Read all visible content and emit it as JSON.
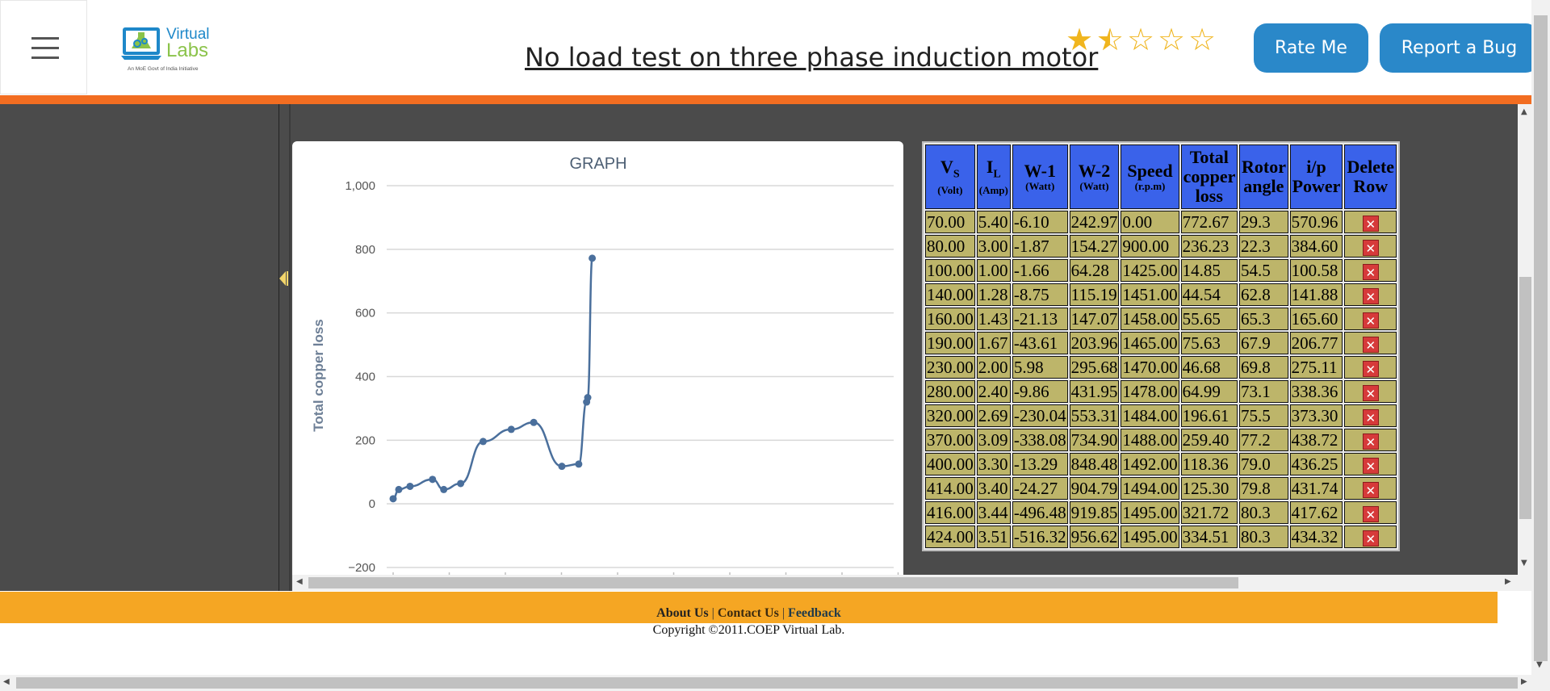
{
  "header": {
    "title": "No load test on three phase induction motor",
    "logo": {
      "name": "Virtual Labs",
      "line1": "Virtual",
      "line2": "Labs",
      "tagline": "An MoE Govt of India Initiative"
    },
    "rating": {
      "value": 1.5,
      "max": 5,
      "color": "#f0b51e"
    },
    "rate_label": "Rate Me",
    "bug_label": "Report a Bug",
    "accent": "#2a88c9",
    "bar_color": "#f26d21"
  },
  "chart": {
    "title": "GRAPH",
    "icons": [
      "collapse-arrow-icon"
    ]
  },
  "chart_data": {
    "type": "line",
    "title": "GRAPH",
    "xlabel": "",
    "ylabel": "Total copper loss",
    "ylim": [
      -200,
      1000
    ],
    "yticks": [
      "1,000",
      "800",
      "600",
      "400",
      "200",
      "0",
      "−200"
    ],
    "ytick_values": [
      1000,
      800,
      600,
      400,
      200,
      0,
      -200
    ],
    "grid": true,
    "series": [
      {
        "x": [
          70,
          80,
          100,
          140,
          160,
          190,
          230,
          280,
          320,
          370,
          400,
          414,
          416,
          424
        ],
        "values": [
          16,
          45,
          55,
          77,
          45,
          64,
          196,
          234,
          256,
          118,
          125,
          320,
          334,
          772
        ]
      }
    ],
    "xlim": [
      70,
      960
    ],
    "color": "#4a6f9c"
  },
  "table": {
    "headers": [
      {
        "main": "V",
        "sub": "S",
        "unit": "(Volt)"
      },
      {
        "main": "I",
        "sub": "L",
        "unit": "(Amp)"
      },
      {
        "main": "W-1",
        "sub": "",
        "unit": "(Watt)"
      },
      {
        "main": "W-2",
        "sub": "",
        "unit": "(Watt)"
      },
      {
        "main": "Speed",
        "sub": "",
        "unit": "(r.p.m)"
      },
      {
        "main": "Total copper loss",
        "sub": "",
        "unit": ""
      },
      {
        "main": "Rotor angle",
        "sub": "",
        "unit": ""
      },
      {
        "main": "i/p Power",
        "sub": "",
        "unit": ""
      },
      {
        "main": "Delete Row",
        "sub": "",
        "unit": ""
      }
    ],
    "rows": [
      [
        "70.00",
        "5.40",
        "-6.10",
        "242.97",
        "0.00",
        "772.67",
        "29.3",
        "570.96"
      ],
      [
        "80.00",
        "3.00",
        "-1.87",
        "154.27",
        "900.00",
        "236.23",
        "22.3",
        "384.60"
      ],
      [
        "100.00",
        "1.00",
        "-1.66",
        "64.28",
        "1425.00",
        "14.85",
        "54.5",
        "100.58"
      ],
      [
        "140.00",
        "1.28",
        "-8.75",
        "115.19",
        "1451.00",
        "44.54",
        "62.8",
        "141.88"
      ],
      [
        "160.00",
        "1.43",
        "-21.13",
        "147.07",
        "1458.00",
        "55.65",
        "65.3",
        "165.60"
      ],
      [
        "190.00",
        "1.67",
        "-43.61",
        "203.96",
        "1465.00",
        "75.63",
        "67.9",
        "206.77"
      ],
      [
        "230.00",
        "2.00",
        "5.98",
        "295.68",
        "1470.00",
        "46.68",
        "69.8",
        "275.11"
      ],
      [
        "280.00",
        "2.40",
        "-9.86",
        "431.95",
        "1478.00",
        "64.99",
        "73.1",
        "338.36"
      ],
      [
        "320.00",
        "2.69",
        "-230.04",
        "553.31",
        "1484.00",
        "196.61",
        "75.5",
        "373.30"
      ],
      [
        "370.00",
        "3.09",
        "-338.08",
        "734.90",
        "1488.00",
        "259.40",
        "77.2",
        "438.72"
      ],
      [
        "400.00",
        "3.30",
        "-13.29",
        "848.48",
        "1492.00",
        "118.36",
        "79.0",
        "436.25"
      ],
      [
        "414.00",
        "3.40",
        "-24.27",
        "904.79",
        "1494.00",
        "125.30",
        "79.8",
        "431.74"
      ],
      [
        "416.00",
        "3.44",
        "-496.48",
        "919.85",
        "1495.00",
        "321.72",
        "80.3",
        "417.62"
      ],
      [
        "424.00",
        "3.51",
        "-516.32",
        "956.62",
        "1495.00",
        "334.51",
        "80.3",
        "434.32"
      ]
    ],
    "delete_icon": "close-icon",
    "header_color": "#3a62ea",
    "cell_color": "#bdb56a",
    "delete_color": "#d63a3a"
  },
  "footer": {
    "links": [
      "About Us",
      "Contact Us",
      "Feedback"
    ],
    "copyright": "Copyright ©2011.COEP Virtual Lab.",
    "color": "#f5a623"
  }
}
